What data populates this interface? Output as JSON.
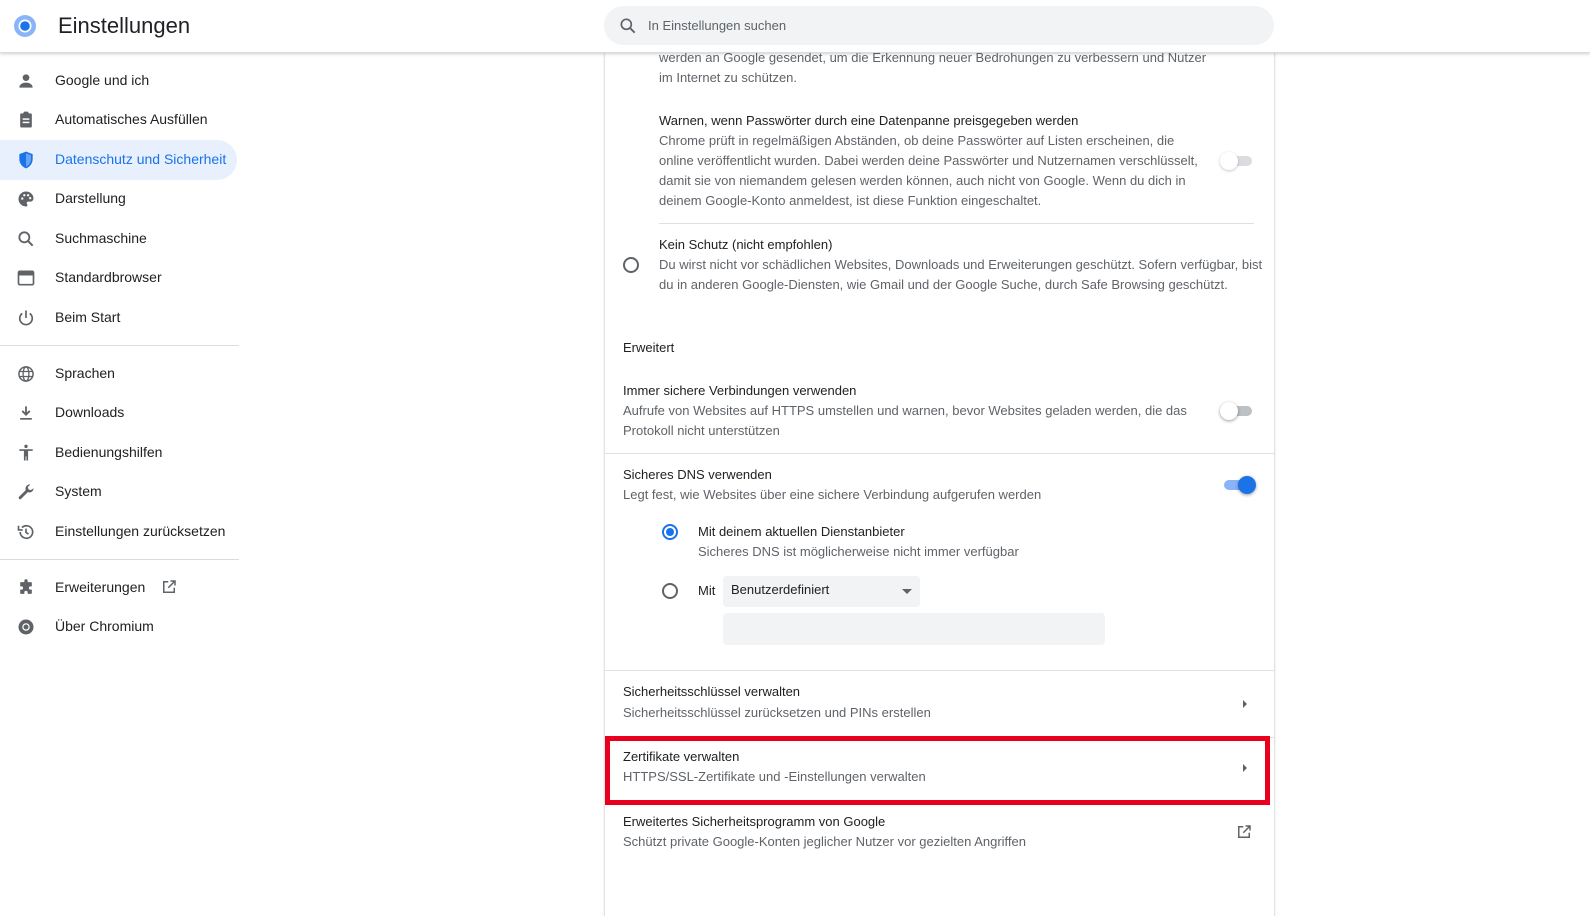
{
  "header": {
    "title": "Einstellungen",
    "search_placeholder": "In Einstellungen suchen",
    "logo_icon": "chromium-logo-icon"
  },
  "sidebar": {
    "items": [
      {
        "label": "Google und ich",
        "icon": "person-icon"
      },
      {
        "label": "Automatisches Ausfüllen",
        "icon": "clipboard-icon"
      },
      {
        "label": "Datenschutz und Sicherheit",
        "icon": "shield-icon",
        "active": true
      },
      {
        "label": "Darstellung",
        "icon": "palette-icon"
      },
      {
        "label": "Suchmaschine",
        "icon": "search-icon"
      },
      {
        "label": "Standardbrowser",
        "icon": "browser-icon"
      },
      {
        "label": "Beim Start",
        "icon": "power-icon"
      },
      {
        "label": "Sprachen",
        "icon": "globe-icon"
      },
      {
        "label": "Downloads",
        "icon": "download-icon"
      },
      {
        "label": "Bedienungshilfen",
        "icon": "accessibility-icon"
      },
      {
        "label": "System",
        "icon": "wrench-icon"
      },
      {
        "label": "Einstellungen zurücksetzen",
        "icon": "history-icon"
      },
      {
        "label": "Erweiterungen",
        "icon": "puzzle-icon"
      },
      {
        "label": "Über Chromium",
        "icon": "chromium-icon"
      }
    ]
  },
  "main": {
    "partial_top": {
      "line1": "werden an Google gesendet, um die Erkennung neuer Bedrohungen zu verbessern und Nutzer",
      "line2": "im Internet zu schützen."
    },
    "password_warning": {
      "title": "Warnen, wenn Passwörter durch eine Datenpanne preisgegeben werden",
      "desc_lines": [
        "Chrome prüft in regelmäßigen Abständen, ob deine Passwörter auf Listen erscheinen, die",
        "online veröffentlicht wurden. Dabei werden deine Passwörter und Nutzernamen verschlüsselt,",
        "damit sie von niemandem gelesen werden können, auch nicht von Google. Wenn du dich in",
        "deinem Google-Konto anmeldest, ist diese Funktion eingeschaltet."
      ],
      "enabled": false
    },
    "no_protection": {
      "title": "Kein Schutz (nicht empfohlen)",
      "desc_lines": [
        "Du wirst nicht vor schädlichen Websites, Downloads und Erweiterungen geschützt. Sofern verfügbar, bist",
        "du in anderen Google-Diensten, wie Gmail und der Google Suche, durch Safe Browsing geschützt."
      ],
      "selected": false
    },
    "advanced_heading": "Erweitert",
    "https_only": {
      "title": "Immer sichere Verbindungen verwenden",
      "desc_lines": [
        "Aufrufe von Websites auf HTTPS umstellen und warnen, bevor Websites geladen werden, die das",
        "Protokoll nicht unterstützen"
      ],
      "enabled": false
    },
    "secure_dns": {
      "title": "Sicheres DNS verwenden",
      "desc": "Legt fest, wie Websites über eine sichere Verbindung aufgerufen werden",
      "enabled": true,
      "option_current": {
        "title": "Mit deinem aktuellen Dienstanbieter",
        "desc": "Sicheres DNS ist möglicherweise nicht immer verfügbar",
        "selected": true
      },
      "option_custom": {
        "label": "Mit",
        "select_value": "Benutzerdefiniert",
        "input_value": "",
        "selected": false
      }
    },
    "security_keys": {
      "title": "Sicherheitsschlüssel verwalten",
      "desc": "Sicherheitsschlüssel zurücksetzen und PINs erstellen"
    },
    "certificates": {
      "title": "Zertifikate verwalten",
      "desc": "HTTPS/SSL-Zertifikate und -Einstellungen verwalten",
      "highlight_color": "#e8001c"
    },
    "advanced_protection": {
      "title": "Erweitertes Sicherheitsprogramm von Google",
      "desc": "Schützt private Google-Konten jeglicher Nutzer vor gezielten Angriffen"
    }
  },
  "colors": {
    "accent": "#1a73e8",
    "active_bg": "#e8f0fe",
    "highlight": "#e8001c"
  }
}
